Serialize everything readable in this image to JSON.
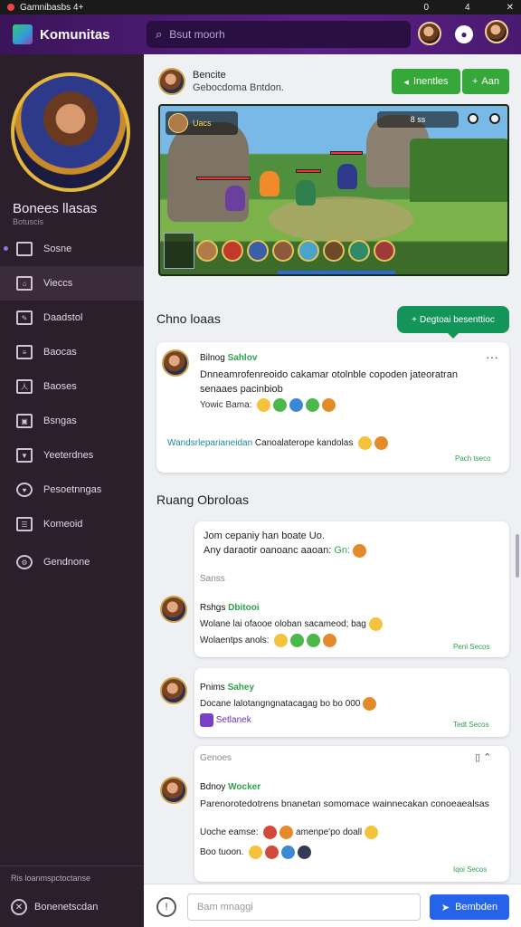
{
  "statusbar": {
    "left": "Gamnibasbs 4+",
    "right_a": "0",
    "right_b": "4"
  },
  "topbar": {
    "title": "Komunitas",
    "search_placeholder": "Bsut moorh"
  },
  "profile": {
    "name": "Bonees llasas",
    "sub": "Botuscis"
  },
  "sidebar": {
    "items": [
      {
        "label": "Sosne"
      },
      {
        "label": "Vieccs"
      },
      {
        "label": "Daadstol"
      },
      {
        "label": "Baocas"
      },
      {
        "label": "Baoses"
      },
      {
        "label": "Bsngas"
      },
      {
        "label": "Yeeterdnes"
      },
      {
        "label": "Pesoetnngas"
      },
      {
        "label": "Komeoid"
      },
      {
        "label": "Gendnone"
      }
    ],
    "footer_top": "Ris loanmspctoctanse",
    "footer_bottom": "Bonenetscdan"
  },
  "post": {
    "author": "Bencite",
    "subtitle": "Gebocdoma Bntdon.",
    "follow_label": "Inentles",
    "add_label": "Aan",
    "hud_left": "Uacs",
    "hud_right": "8 ss"
  },
  "section1": {
    "title": "Chno loaas",
    "chat_button": "Degtoai besenttioc"
  },
  "comment1": {
    "name_a": "Bilnog",
    "name_b": "Sahlov",
    "text": "Dnneamrofenreoido cakamar otolnble copoden jateoratran senaaes pacinbiob",
    "reactions_label": "Yowic Bama:",
    "link": "Wandsrleparianeidan",
    "link_tail": "Canoalaterope kandolas",
    "reply": "Pach tseco"
  },
  "section2": {
    "title": "Ruang Obroloas"
  },
  "thread": {
    "line1": "Jom cepaniy han boate Uo.",
    "line2": "Any daraotir oanoanc aaoan:",
    "line2_tag": "Gn:",
    "label": "Sanss",
    "m1_name_a": "Rshgs",
    "m1_name_b": "Dbitooi",
    "m1_text": "Wolane lai ofaooe oloban sacameod; bag",
    "m1_react": "Wolaentps anols:",
    "m1_reply": "Penl Secos"
  },
  "comment2": {
    "name_a": "Pnims",
    "name_b": "Sahey",
    "text": "Docane lalotangngnatacagag bo bo 000",
    "badge": "Setlanek",
    "reply": "Tedt Secos"
  },
  "comment3": {
    "label": "Genoes",
    "name_a": "Bdnoy",
    "name_b": "Wocker",
    "text": "Parenorotedotrens bnanetan somomace wainnecakan conoeaealsas",
    "react1": "Uoche eamse:",
    "react1_tail": "amenpe'po doall",
    "react2": "Boo tuoon.",
    "reply": "Iqoi Secos"
  },
  "composer": {
    "placeholder": "Bam mnaggi",
    "send_label": "Bembden"
  },
  "colors": {
    "topbar": "#4a1a70",
    "sidebar": "#2b1f2b",
    "green": "#36a83a",
    "send": "#2563eb"
  }
}
